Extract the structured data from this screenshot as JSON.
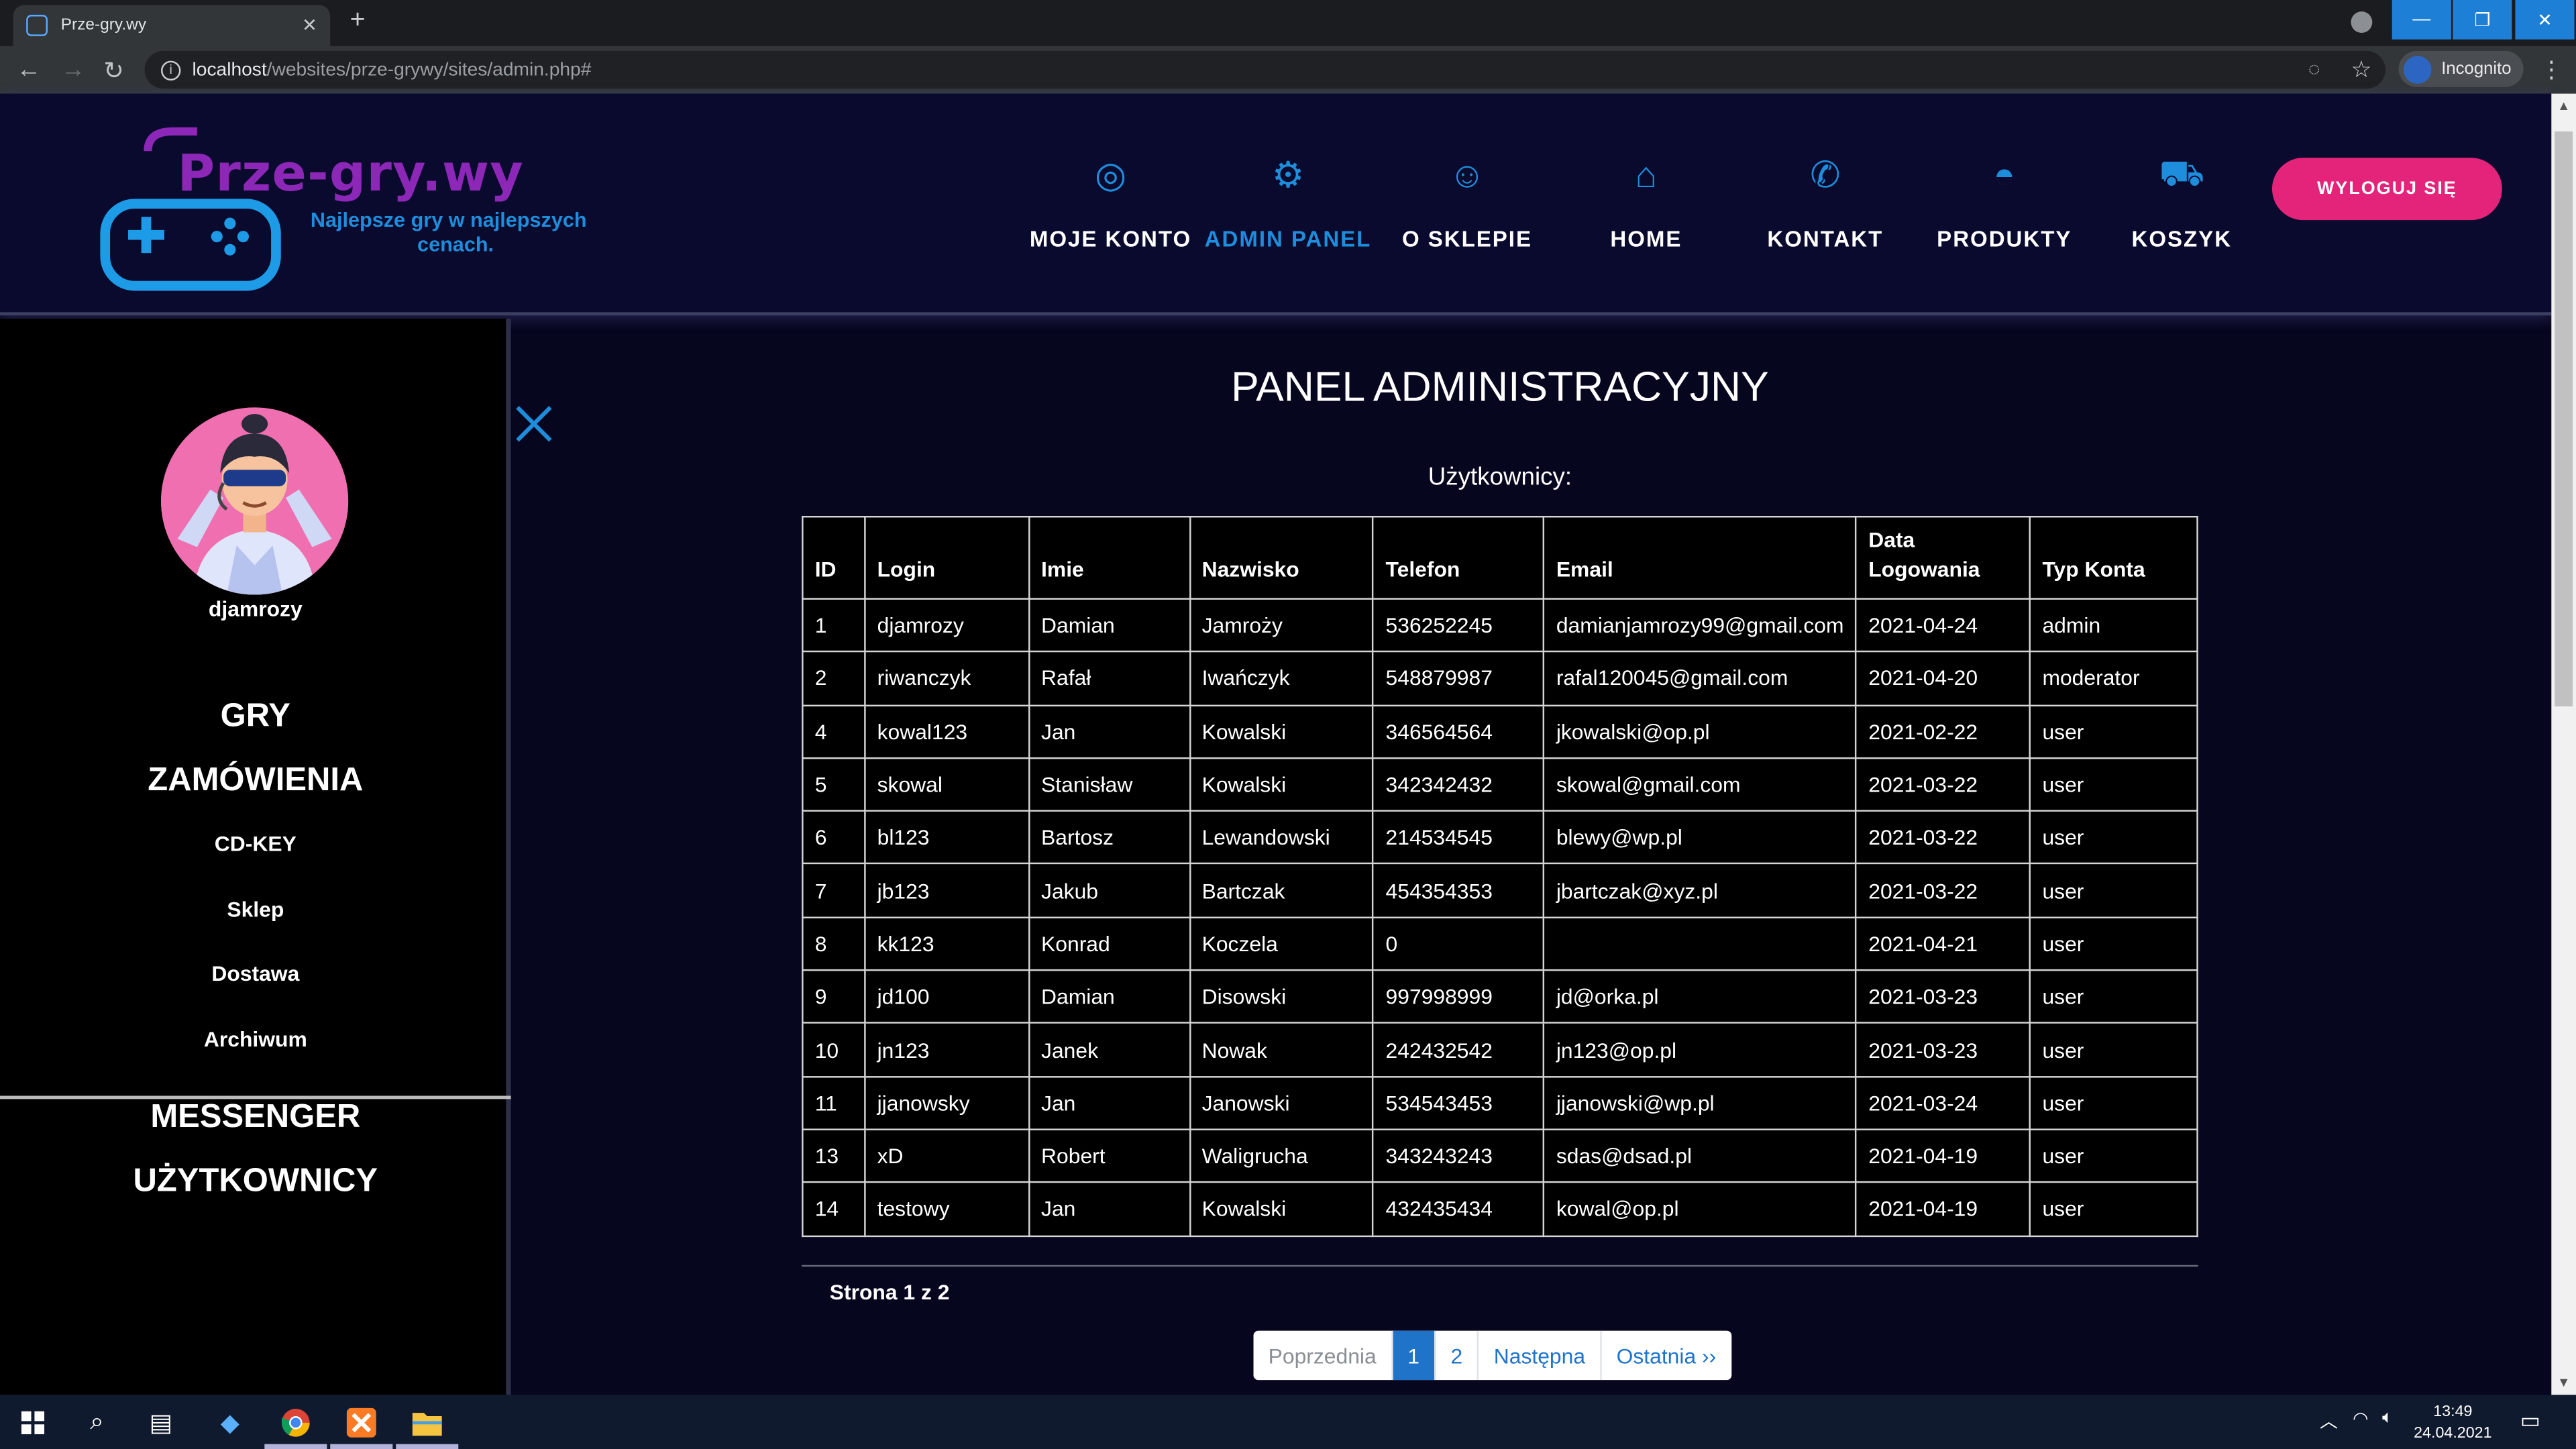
{
  "browser": {
    "tab_title": "Prze-gry.wy",
    "tab_close": "✕",
    "new_tab": "+",
    "url_host": "localhost",
    "url_path": "/websites/prze-grywy/sites/admin.php#",
    "incognito_label": "Incognito",
    "win_min": "—",
    "win_max": "❐",
    "win_close": "✕"
  },
  "logo": {
    "title": "Prze-gry.wy",
    "tagline_1": "Najlepsze gry w najlepszych",
    "tagline_2": "cenach."
  },
  "nav": {
    "items": [
      {
        "label": "MOJE KONTO",
        "icon": "account-icon",
        "glyph": "◎"
      },
      {
        "label": "ADMIN PANEL",
        "icon": "admin-icon",
        "glyph": "⚙"
      },
      {
        "label": "O SKLEPIE",
        "icon": "about-icon",
        "glyph": "☺"
      },
      {
        "label": "HOME",
        "icon": "home-icon",
        "glyph": "⌂"
      },
      {
        "label": "KONTAKT",
        "icon": "phone-icon",
        "glyph": "✆"
      },
      {
        "label": "PRODUKTY",
        "icon": "gamepad-icon",
        "glyph": "◓"
      },
      {
        "label": "KOSZYK",
        "icon": "cart-icon",
        "glyph": "⛟"
      }
    ],
    "active": "ADMIN PANEL",
    "logout_label": "WYLOGUJ SIĘ"
  },
  "sidebar": {
    "username": "djamrozy",
    "items": [
      {
        "label": "GRY"
      },
      {
        "label": "ZAMÓWIENIA"
      },
      {
        "label": "CD-KEY"
      },
      {
        "label": "Sklep"
      },
      {
        "label": "Dostawa"
      },
      {
        "label": "Archiwum"
      },
      {
        "label": "MESSENGER"
      },
      {
        "label": "UŻYTKOWNICY"
      }
    ]
  },
  "main": {
    "title": "PANEL ADMINISTRACYJNY",
    "subtitle": "Użytkownicy:",
    "columns": [
      "ID",
      "Login",
      "Imie",
      "Nazwisko",
      "Telefon",
      "Email",
      "Data Logowania",
      "Typ Konta"
    ],
    "rows": [
      [
        "1",
        "djamrozy",
        "Damian",
        "Jamroży",
        "536252245",
        "damianjamrozy99@gmail.com",
        "2021-04-24",
        "admin"
      ],
      [
        "2",
        "riwanczyk",
        "Rafał",
        "Iwańczyk",
        "548879987",
        "rafal120045@gmail.com",
        "2021-04-20",
        "moderator"
      ],
      [
        "4",
        "kowal123",
        "Jan",
        "Kowalski",
        "346564564",
        "jkowalski@op.pl",
        "2021-02-22",
        "user"
      ],
      [
        "5",
        "skowal",
        "Stanisław",
        "Kowalski",
        "342342432",
        "skowal@gmail.com",
        "2021-03-22",
        "user"
      ],
      [
        "6",
        "bl123",
        "Bartosz",
        "Lewandowski",
        "214534545",
        "blewy@wp.pl",
        "2021-03-22",
        "user"
      ],
      [
        "7",
        "jb123",
        "Jakub",
        "Bartczak",
        "454354353",
        "jbartczak@xyz.pl",
        "2021-03-22",
        "user"
      ],
      [
        "8",
        "kk123",
        "Konrad",
        "Koczela",
        "0",
        "",
        "2021-04-21",
        "user"
      ],
      [
        "9",
        "jd100",
        "Damian",
        "Disowski",
        "997998999",
        "jd@orka.pl",
        "2021-03-23",
        "user"
      ],
      [
        "10",
        "jn123",
        "Janek",
        "Nowak",
        "242432542",
        "jn123@op.pl",
        "2021-03-23",
        "user"
      ],
      [
        "11",
        "jjanowsky",
        "Jan",
        "Janowski",
        "534543453",
        "jjanowski@wp.pl",
        "2021-03-24",
        "user"
      ],
      [
        "13",
        "xD",
        "Robert",
        "Waligrucha",
        "343243243",
        "sdas@dsad.pl",
        "2021-04-19",
        "user"
      ],
      [
        "14",
        "testowy",
        "Jan",
        "Kowalski",
        "432435434",
        "kowal@op.pl",
        "2021-04-19",
        "user"
      ]
    ],
    "page_info": "Strona 1 z 2",
    "pagination": {
      "prev": "Poprzednia",
      "pages": [
        "1",
        "2"
      ],
      "current": "1",
      "next": "Następna",
      "last": "Ostatnia ››"
    }
  },
  "taskbar": {
    "time": "13:49",
    "date": "24.04.2021"
  },
  "colors": {
    "accent_blue": "#1e8ddb",
    "logo_purple": "#8c27b7",
    "logout_pink": "#e4247a",
    "background": "#07061f"
  }
}
